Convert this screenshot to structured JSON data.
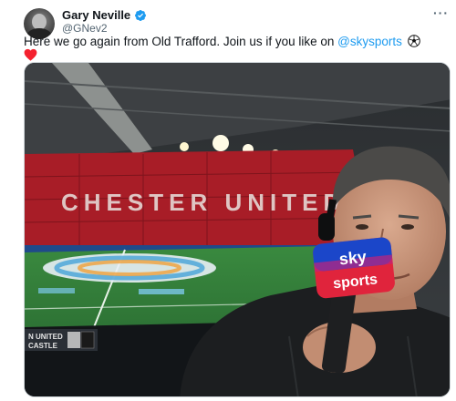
{
  "tweet": {
    "display_name": "Gary Neville",
    "handle": "@GNev2",
    "text_before": "Here we go again from Old Trafford. Join us if you like on ",
    "mention": "@skysports",
    "emojis": [
      "soccer-ball-icon",
      "red-heart-icon"
    ],
    "verified": true
  },
  "media": {
    "alt": "Selfie in the stadium commentary position holding a Sky Sports microphone",
    "stand_lettering": "CHESTER UNITED",
    "mic_brand_top": "sky",
    "mic_brand_bottom": "sports",
    "board_text_1": "N UNITED",
    "board_text_2": "CASTLE"
  },
  "colors": {
    "accent": "#1d9bf0",
    "text": "#0f1419",
    "muted": "#536471",
    "heart": "#f4212e",
    "seats": "#b3202a",
    "pitch": "#2f7a38",
    "mic_red": "#e0243c",
    "mic_blue": "#1b46c9"
  }
}
